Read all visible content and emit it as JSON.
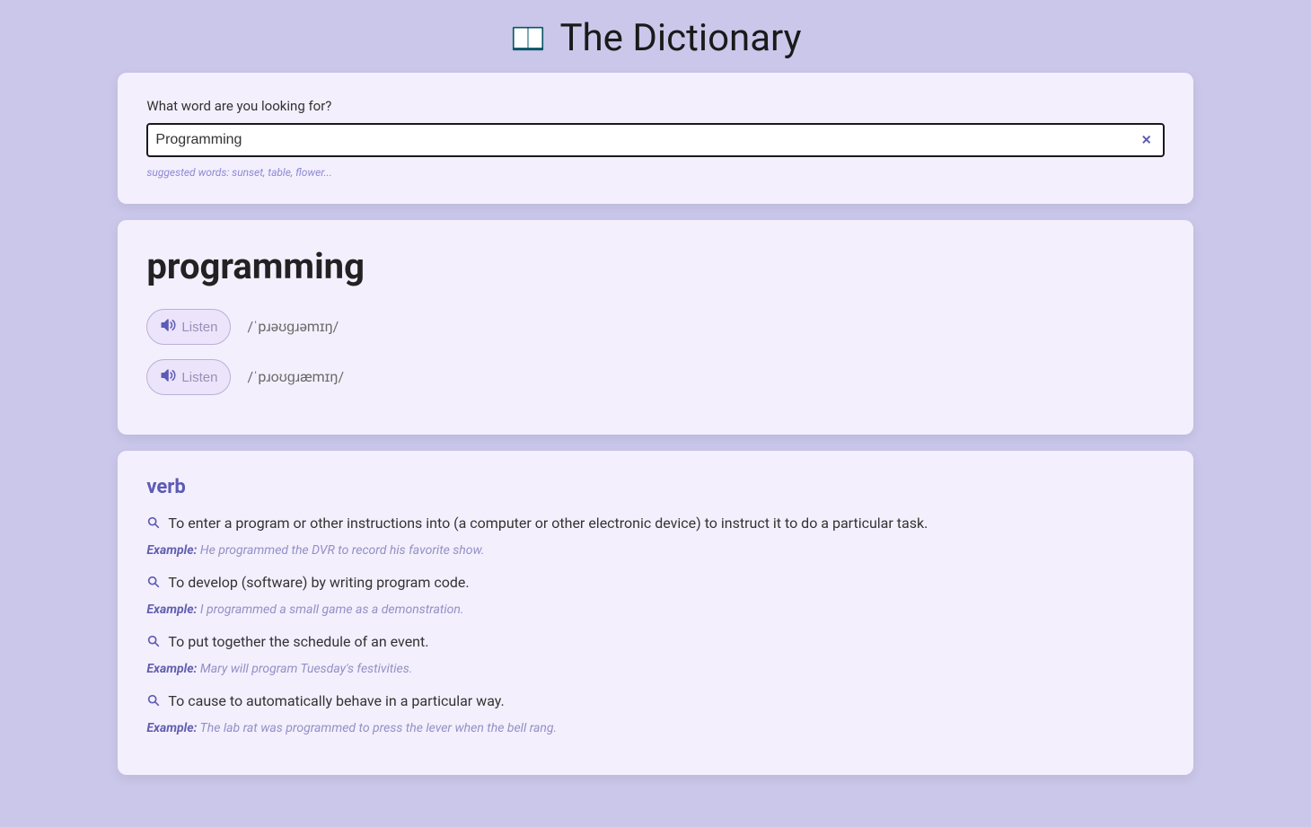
{
  "app": {
    "title": "The Dictionary"
  },
  "search": {
    "label": "What word are you looking for?",
    "value": "Programming",
    "suggested": "suggested words: sunset, table, flower..."
  },
  "result": {
    "word": "programming",
    "phonetics": [
      {
        "listen_label": "Listen",
        "text": "/ˈpɹəʊɡɹəmɪŋ/"
      },
      {
        "listen_label": "Listen",
        "text": "/ˈpɹoʊɡɹæmɪŋ/"
      }
    ]
  },
  "meanings": {
    "part_of_speech": "verb",
    "example_label": "Example:",
    "entries": [
      {
        "definition": "To enter a program or other instructions into (a computer or other electronic device) to instruct it to do a particular task.",
        "example": "He programmed the DVR to record his favorite show."
      },
      {
        "definition": "To develop (software) by writing program code.",
        "example": "I programmed a small game as a demonstration."
      },
      {
        "definition": "To put together the schedule of an event.",
        "example": "Mary will program Tuesday's festivities."
      },
      {
        "definition": "To cause to automatically behave in a particular way.",
        "example": "The lab rat was programmed to press the lever when the bell rang."
      }
    ]
  }
}
